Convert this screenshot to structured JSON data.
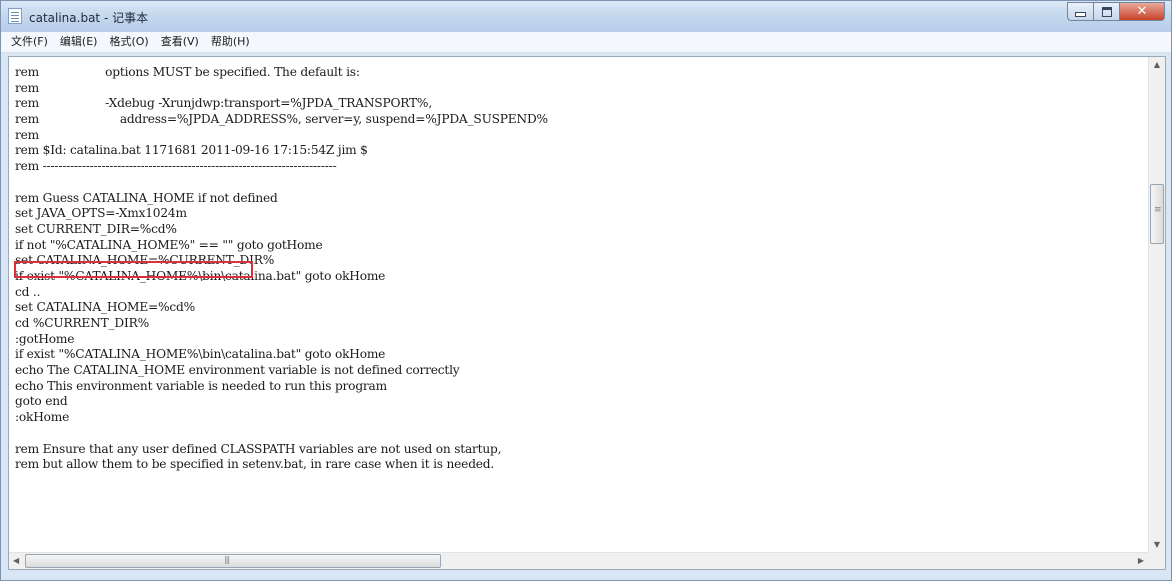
{
  "window": {
    "title": "catalina.bat - 记事本",
    "minimize_label": "minimize",
    "maximize_label": "maximize",
    "close_glyph": "✕"
  },
  "menu": [
    {
      "label": "文件(F)"
    },
    {
      "label": "编辑(E)"
    },
    {
      "label": "格式(O)"
    },
    {
      "label": "查看(V)"
    },
    {
      "label": "帮助(H)"
    }
  ],
  "editor": {
    "lines": [
      "rem                  options MUST be specified. The default is:",
      "rem",
      "rem                  -Xdebug -Xrunjdwp:transport=%JPDA_TRANSPORT%,",
      "rem                      address=%JPDA_ADDRESS%, server=y, suspend=%JPDA_SUSPEND%",
      "rem",
      "rem $Id: catalina.bat 1171681 2011-09-16 17:15:54Z jim $",
      "rem ---------------------------------------------------------------------------",
      "",
      "rem Guess CATALINA_HOME if not defined",
      "set JAVA_OPTS=-Xmx1024m",
      "set CURRENT_DIR=%cd%",
      "if not \"%CATALINA_HOME%\" == \"\" goto gotHome",
      "set CATALINA_HOME=%CURRENT_DIR%",
      "if exist \"%CATALINA_HOME%\\bin\\catalina.bat\" goto okHome",
      "cd ..",
      "set CATALINA_HOME=%cd%",
      "cd %CURRENT_DIR%",
      ":gotHome",
      "if exist \"%CATALINA_HOME%\\bin\\catalina.bat\" goto okHome",
      "echo The CATALINA_HOME environment variable is not defined correctly",
      "echo This environment variable is needed to run this program",
      "goto end",
      ":okHome",
      "",
      "rem Ensure that any user defined CLASSPATH variables are not used on startup,",
      "rem but allow them to be specified in setenv.bat, in rare case when it is needed."
    ],
    "highlight_color": "#d8323a"
  },
  "scrollbars": {
    "up_arrow": "▲",
    "down_arrow": "▼",
    "left_arrow": "◀",
    "right_arrow": "▶"
  }
}
